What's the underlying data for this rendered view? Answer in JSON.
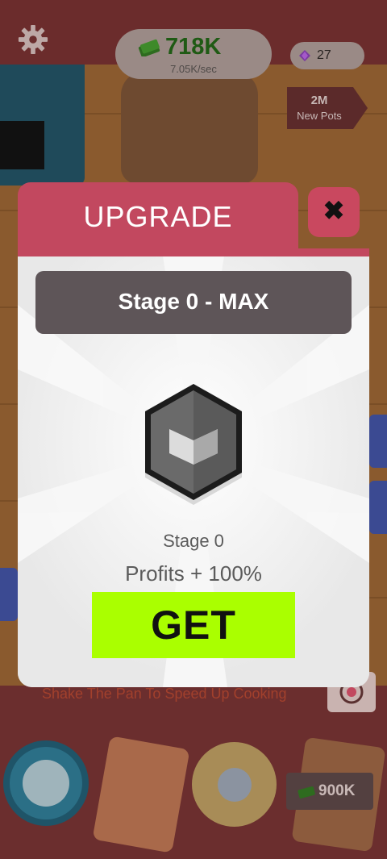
{
  "hud": {
    "money": "718K",
    "money_rate": "7.05K/sec",
    "gems": "27",
    "new_pots_value": "2M",
    "new_pots_label": "New Pots",
    "bottom_price": "900K"
  },
  "scene": {
    "hint": "Shake The Pan To Speed Up Cooking"
  },
  "dialog": {
    "title": "UPGRADE",
    "close_glyph": "✖",
    "stage_banner": "Stage 0 - MAX",
    "stage_label": "Stage 0",
    "profits_label": "Profits + 100%",
    "get_label": "GET"
  },
  "colors": {
    "header": "#c2485f",
    "get_button": "#aaff00",
    "banner": "#5e5558",
    "money_text": "#1f5a14"
  },
  "icons": [
    "gear-icon",
    "cash-icon",
    "gem-icon",
    "close-icon",
    "stage-badge-icon",
    "camera-icon"
  ]
}
